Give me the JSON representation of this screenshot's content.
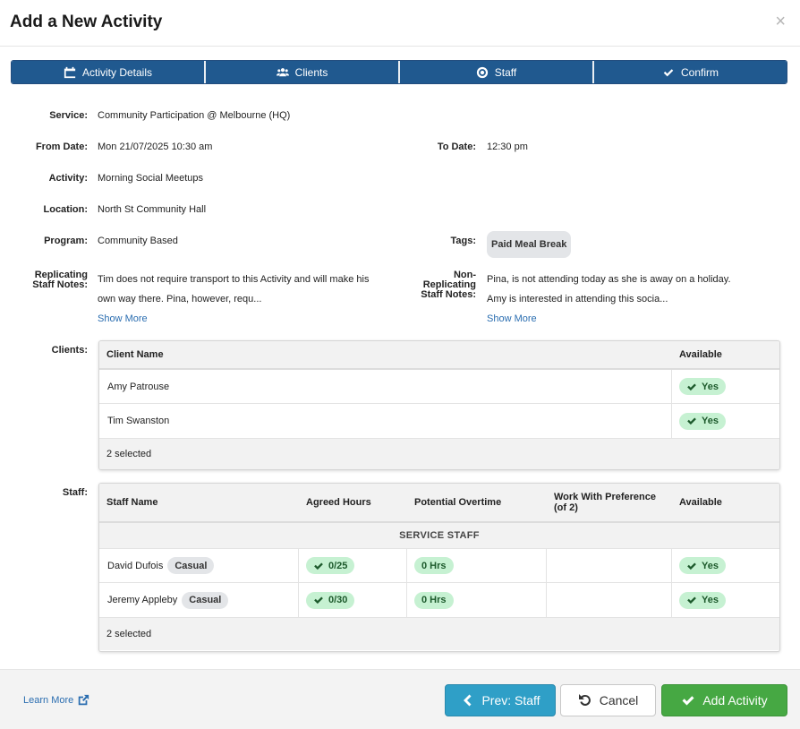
{
  "modal": {
    "title": "Add a New Activity",
    "close_label": "×"
  },
  "steps": [
    {
      "label": "Activity Details",
      "icon": "calendar-icon"
    },
    {
      "label": "Clients",
      "icon": "users-icon"
    },
    {
      "label": "Staff",
      "icon": "lifebuoy-icon"
    },
    {
      "label": "Confirm",
      "icon": "check-icon"
    }
  ],
  "details": {
    "service_label": "Service:",
    "service": "Community Participation @ Melbourne (HQ)",
    "from_label": "From Date:",
    "from": "Mon 21/07/2025 10:30 am",
    "to_label": "To Date:",
    "to": "12:30 pm",
    "activity_label": "Activity:",
    "activity": "Morning Social Meetups",
    "location_label": "Location:",
    "location": "North St Community Hall",
    "program_label": "Program:",
    "program": "Community Based",
    "tags_label": "Tags:",
    "tag": "Paid Meal Break",
    "rep_notes_label_1": "Replicating",
    "rep_notes_label_2": "Staff Notes:",
    "rep_notes_line1": "Tim does not require transport to this Activity and will make his",
    "rep_notes_line2": "own way there. Pina, however, requ...",
    "nonrep_notes_label_1": "Non-",
    "nonrep_notes_label_2": "Replicating",
    "nonrep_notes_label_3": "Staff Notes:",
    "nonrep_notes_line1": "Pina, is not attending today as she is away on a holiday.",
    "nonrep_notes_line2": "Amy is interested in attending this socia...",
    "show_more": "Show More"
  },
  "clients": {
    "label": "Clients:",
    "headers": {
      "name": "Client Name",
      "available": "Available"
    },
    "rows": [
      {
        "name": "Amy Patrouse",
        "available": "Yes"
      },
      {
        "name": "Tim Swanston",
        "available": "Yes"
      }
    ],
    "footer": "2 selected"
  },
  "staff": {
    "label": "Staff:",
    "headers": {
      "name": "Staff Name",
      "agreed": "Agreed Hours",
      "overtime": "Potential Overtime",
      "pref_1": "Work With Preference",
      "pref_2": "(of 2)",
      "available": "Available"
    },
    "group": "SERVICE STAFF",
    "rows": [
      {
        "name": "David Dufois",
        "type": "Casual",
        "agreed": "0/25",
        "overtime": "0 Hrs",
        "pref": "",
        "available": "Yes"
      },
      {
        "name": "Jeremy Appleby",
        "type": "Casual",
        "agreed": "0/30",
        "overtime": "0 Hrs",
        "pref": "",
        "available": "Yes"
      }
    ],
    "footer": "2 selected"
  },
  "footer": {
    "learn_more": "Learn More",
    "prev": "Prev: Staff",
    "cancel": "Cancel",
    "add": "Add Activity"
  },
  "colors": {
    "step_bg": "#20598f",
    "prev_btn": "#2f9fc7",
    "add_btn": "#46a843",
    "yes_pill": "#c6f1d2",
    "link": "#2a6db0"
  }
}
